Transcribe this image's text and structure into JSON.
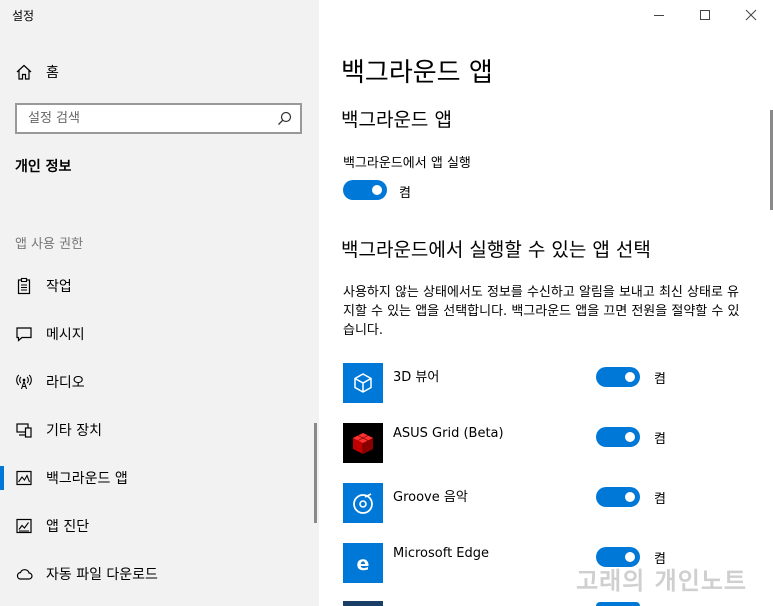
{
  "window": {
    "title": "설정",
    "controls": [
      "minimize-icon",
      "maximize-icon",
      "close-icon"
    ]
  },
  "sidebar": {
    "home_label": "홈",
    "search": {
      "placeholder": "설정 검색",
      "value": ""
    },
    "section_title": "개인 정보",
    "group_title": "앱 사용 권한",
    "items": [
      {
        "label": "작업",
        "icon": "clipboard-icon"
      },
      {
        "label": "메시지",
        "icon": "chat-icon"
      },
      {
        "label": "라디오",
        "icon": "radio-antenna-icon"
      },
      {
        "label": "기타 장치",
        "icon": "devices-icon"
      },
      {
        "label": "백그라운드 앱",
        "icon": "background-apps-icon",
        "active": true
      },
      {
        "label": "앱 진단",
        "icon": "diagnostics-icon"
      },
      {
        "label": "자동 파일 다운로드",
        "icon": "cloud-icon"
      }
    ]
  },
  "main": {
    "page_title": "백그라운드 앱",
    "subtitle": "백그라운드 앱",
    "master_toggle": {
      "label": "백그라운드에서 앱 실행",
      "state": "켬"
    },
    "section_title": "백그라운드에서 실행할 수 있는 앱 선택",
    "description": "사용하지 않는 상태에서도 정보를 수신하고 알림을 보내고 최신 상태로 유지할 수 있는 앱을 선택합니다. 백그라운드 앱을 끄면 전원을 절약할 수 있습니다.",
    "apps": [
      {
        "name": "3D 뷰어",
        "state": "켬",
        "icon": "3d-viewer-icon"
      },
      {
        "name": "ASUS Grid (Beta)",
        "state": "켬",
        "icon": "asus-grid-icon"
      },
      {
        "name": "Groove 음악",
        "state": "켬",
        "icon": "groove-music-icon"
      },
      {
        "name": "Microsoft Edge",
        "state": "켬",
        "icon": "edge-icon"
      }
    ]
  },
  "watermark": "고래의 개인노트",
  "colors": {
    "accent": "#0078d7",
    "sidebar_bg": "#f2f2f2",
    "asus_tile": "#000000"
  }
}
